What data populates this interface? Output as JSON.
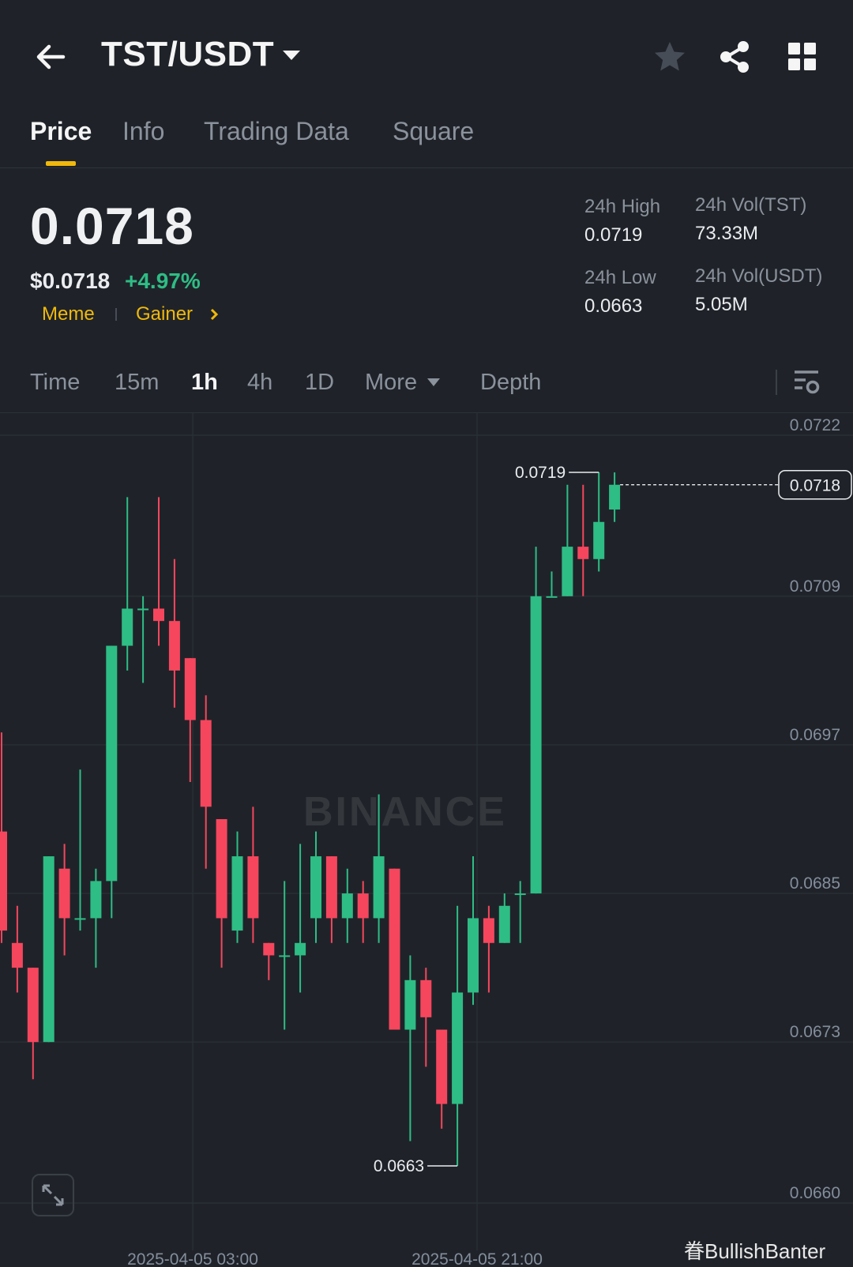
{
  "header": {
    "pair": "TST/USDT",
    "icons": [
      "back-arrow-icon",
      "caret-down-icon",
      "star-icon",
      "share-icon",
      "grid-icon"
    ]
  },
  "tabs": [
    {
      "label": "Price",
      "active": true
    },
    {
      "label": "Info",
      "active": false
    },
    {
      "label": "Trading Data",
      "active": false
    },
    {
      "label": "Square",
      "active": false
    }
  ],
  "ticker": {
    "price": "0.0718",
    "price_usd": "$0.0718",
    "change": "+4.97%",
    "tags": [
      "Meme",
      "Gainer"
    ],
    "stats": {
      "high_label": "24h High",
      "high_value": "0.0719",
      "low_label": "24h Low",
      "low_value": "0.0663",
      "vol_base_label": "24h Vol(TST)",
      "vol_base_value": "73.33M",
      "vol_quote_label": "24h Vol(USDT)",
      "vol_quote_value": "5.05M"
    }
  },
  "intervals": {
    "items": [
      "Time",
      "15m",
      "1h",
      "4h",
      "1D"
    ],
    "active": "1h",
    "more": "More",
    "depth": "Depth"
  },
  "colors": {
    "background": "#1f2329",
    "up": "#2ebd85",
    "down": "#f6465d",
    "accent": "#f0b90b",
    "text_muted": "#8b929c"
  },
  "chart_data": {
    "type": "candlestick",
    "interval": "1h",
    "y_ticks": [
      "0.0722",
      "0.0709",
      "0.0697",
      "0.0685",
      "0.0673",
      "0.0660"
    ],
    "ylim": [
      0.066,
      0.0722
    ],
    "x_ticks": [
      "2025-04-05 03:00",
      "2025-04-05 21:00"
    ],
    "last_price_label": "0.0718",
    "annotations": {
      "high": "0.0719",
      "low": "0.0663"
    },
    "watermark": "BINANCE",
    "candles": [
      {
        "o": 0.069,
        "h": 0.0698,
        "l": 0.0681,
        "c": 0.0682
      },
      {
        "o": 0.0681,
        "h": 0.0684,
        "l": 0.0677,
        "c": 0.0679
      },
      {
        "o": 0.0679,
        "h": 0.0679,
        "l": 0.067,
        "c": 0.0673
      },
      {
        "o": 0.0673,
        "h": 0.0688,
        "l": 0.0674,
        "c": 0.0688
      },
      {
        "o": 0.0687,
        "h": 0.0689,
        "l": 0.068,
        "c": 0.0683
      },
      {
        "o": 0.0683,
        "h": 0.0695,
        "l": 0.0682,
        "c": 0.0683
      },
      {
        "o": 0.0683,
        "h": 0.0687,
        "l": 0.0679,
        "c": 0.0686
      },
      {
        "o": 0.0686,
        "h": 0.0705,
        "l": 0.0683,
        "c": 0.0705
      },
      {
        "o": 0.0705,
        "h": 0.0717,
        "l": 0.0703,
        "c": 0.0708
      },
      {
        "o": 0.0708,
        "h": 0.0709,
        "l": 0.0702,
        "c": 0.0708
      },
      {
        "o": 0.0708,
        "h": 0.0717,
        "l": 0.0705,
        "c": 0.0707
      },
      {
        "o": 0.0707,
        "h": 0.0712,
        "l": 0.07,
        "c": 0.0703
      },
      {
        "o": 0.0704,
        "h": 0.0703,
        "l": 0.0694,
        "c": 0.0699
      },
      {
        "o": 0.0699,
        "h": 0.0701,
        "l": 0.0687,
        "c": 0.0692
      },
      {
        "o": 0.0691,
        "h": 0.0691,
        "l": 0.0679,
        "c": 0.0683
      },
      {
        "o": 0.0682,
        "h": 0.069,
        "l": 0.0681,
        "c": 0.0688
      },
      {
        "o": 0.0688,
        "h": 0.0692,
        "l": 0.0681,
        "c": 0.0683
      },
      {
        "o": 0.0681,
        "h": 0.0681,
        "l": 0.0678,
        "c": 0.068
      },
      {
        "o": 0.068,
        "h": 0.0686,
        "l": 0.0674,
        "c": 0.068
      },
      {
        "o": 0.068,
        "h": 0.0689,
        "l": 0.0677,
        "c": 0.0681
      },
      {
        "o": 0.0683,
        "h": 0.069,
        "l": 0.0681,
        "c": 0.0688
      },
      {
        "o": 0.0688,
        "h": 0.0686,
        "l": 0.0681,
        "c": 0.0683
      },
      {
        "o": 0.0683,
        "h": 0.0687,
        "l": 0.0681,
        "c": 0.0685
      },
      {
        "o": 0.0685,
        "h": 0.0686,
        "l": 0.0681,
        "c": 0.0683
      },
      {
        "o": 0.0683,
        "h": 0.0693,
        "l": 0.0681,
        "c": 0.0688
      },
      {
        "o": 0.0687,
        "h": 0.0687,
        "l": 0.0674,
        "c": 0.0674
      },
      {
        "o": 0.0674,
        "h": 0.068,
        "l": 0.0665,
        "c": 0.0678
      },
      {
        "o": 0.0678,
        "h": 0.0679,
        "l": 0.0671,
        "c": 0.0675
      },
      {
        "o": 0.0674,
        "h": 0.0674,
        "l": 0.0666,
        "c": 0.0668
      },
      {
        "o": 0.0668,
        "h": 0.0684,
        "l": 0.0663,
        "c": 0.0677
      },
      {
        "o": 0.0677,
        "h": 0.0688,
        "l": 0.0676,
        "c": 0.0683
      },
      {
        "o": 0.0683,
        "h": 0.0684,
        "l": 0.0677,
        "c": 0.0681
      },
      {
        "o": 0.0681,
        "h": 0.0685,
        "l": 0.0682,
        "c": 0.0684
      },
      {
        "o": 0.0685,
        "h": 0.0686,
        "l": 0.0681,
        "c": 0.0685
      },
      {
        "o": 0.0685,
        "h": 0.0713,
        "l": 0.0685,
        "c": 0.0709
      },
      {
        "o": 0.0709,
        "h": 0.0711,
        "l": 0.0709,
        "c": 0.0709
      },
      {
        "o": 0.0709,
        "h": 0.0718,
        "l": 0.0709,
        "c": 0.0713
      },
      {
        "o": 0.0713,
        "h": 0.0718,
        "l": 0.0709,
        "c": 0.0712
      },
      {
        "o": 0.0712,
        "h": 0.0719,
        "l": 0.0711,
        "c": 0.0715
      },
      {
        "o": 0.0716,
        "h": 0.0719,
        "l": 0.0715,
        "c": 0.0718
      }
    ]
  },
  "watermark_user": "眷BullishBanter"
}
